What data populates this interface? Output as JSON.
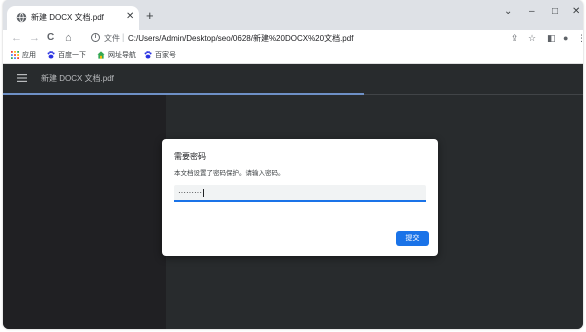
{
  "tab": {
    "title": "新建 DOCX 文档.pdf",
    "close": "✕"
  },
  "newtab": "+",
  "window_controls": {
    "chevron": "⌄",
    "minimize": "–",
    "maximize": "□",
    "close": "✕"
  },
  "nav": {
    "back": "←",
    "forward": "→",
    "reload": "C",
    "home": "⌂"
  },
  "address": {
    "scheme": "文件",
    "separator": "|",
    "url": "C:/Users/Admin/Desktop/seo/0628/新建%20DOCX%20文档.pdf"
  },
  "toolbar_right": {
    "share": "⇪",
    "star": "☆",
    "sidepanel": "◧",
    "profile": "●",
    "menu": "⋮"
  },
  "bookmarks": [
    {
      "label": "应用",
      "icon": "apps-grid-icon"
    },
    {
      "label": "百度一下",
      "icon": "baidu-paw-icon"
    },
    {
      "label": "网址导航",
      "icon": "nav-house-icon"
    },
    {
      "label": "百家号",
      "icon": "baidu-paw-icon"
    }
  ],
  "viewer": {
    "title": "新建 DOCX 文档.pdf"
  },
  "dialog": {
    "title": "需要密码",
    "message": "本文档设置了密码保护。请输入密码。",
    "password_value": "·········",
    "submit_label": "提交"
  },
  "colors": {
    "accent": "#1a73e8",
    "pdf_toolbar": "#323639",
    "viewer_bg": "#333639",
    "sidebar_bg": "#28292c",
    "progress": "#8ab4f8"
  }
}
